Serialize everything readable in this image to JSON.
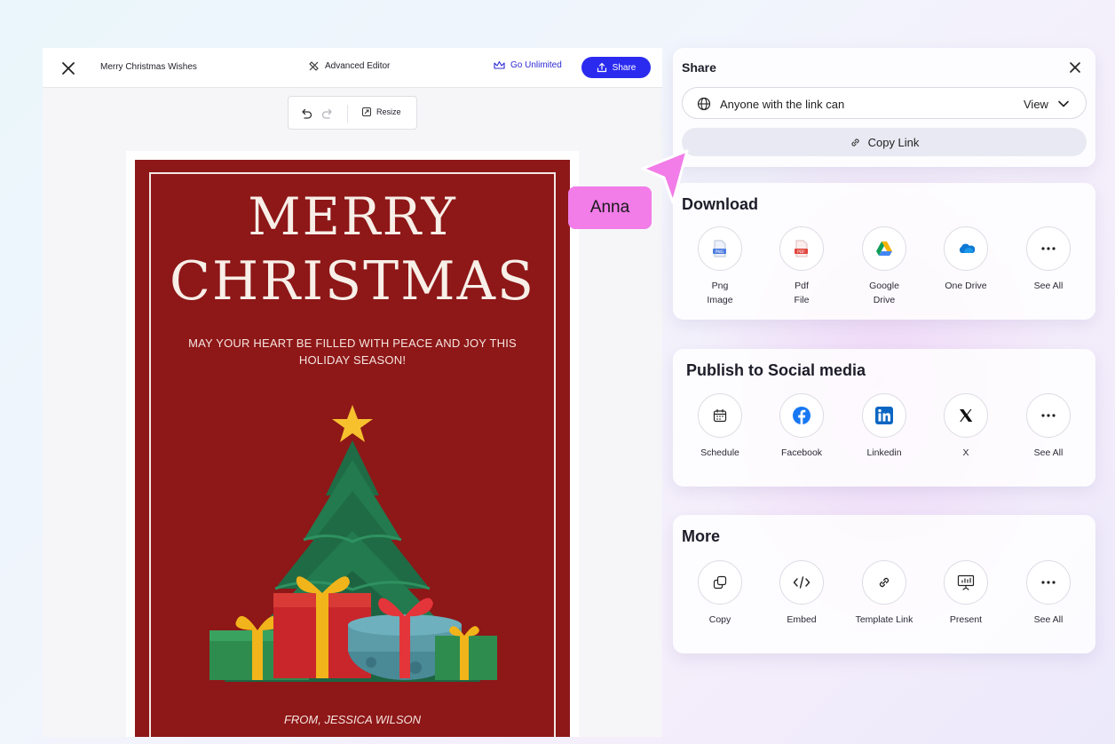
{
  "editor": {
    "doc_title": "Merry Christmas Wishes",
    "advanced_editor": "Advanced Editor",
    "go_unlimited": "Go Unlimited",
    "share": "Share",
    "resize": "Resize"
  },
  "card": {
    "line1": "MERRY",
    "line2": "CHRISTMAS",
    "wish": "MAY YOUR HEART BE FILLED WITH PEACE AND JOY THIS HOLIDAY SEASON!",
    "from": "FROM, JESSICA WILSON"
  },
  "share_panel": {
    "title": "Share",
    "access_text": "Anyone with the link can",
    "access_value": "View",
    "copy_link": "Copy Link"
  },
  "download": {
    "title": "Download",
    "options": [
      {
        "label": "Png\nImage",
        "icon": "png-file-icon"
      },
      {
        "label": "Pdf\nFile",
        "icon": "pdf-file-icon"
      },
      {
        "label": "Google\nDrive",
        "icon": "google-drive-icon"
      },
      {
        "label": "One Drive",
        "icon": "onedrive-icon"
      },
      {
        "label": "See All",
        "icon": "more-dots-icon"
      }
    ]
  },
  "social": {
    "title": "Publish to Social media",
    "options": [
      {
        "label": "Schedule",
        "icon": "calendar-icon"
      },
      {
        "label": "Facebook",
        "icon": "facebook-icon"
      },
      {
        "label": "Linkedin",
        "icon": "linkedin-icon"
      },
      {
        "label": "X",
        "icon": "x-logo-icon"
      },
      {
        "label": "See All",
        "icon": "more-dots-icon"
      }
    ]
  },
  "more": {
    "title": "More",
    "options": [
      {
        "label": "Copy",
        "icon": "copy-icon"
      },
      {
        "label": "Embed",
        "icon": "code-icon"
      },
      {
        "label": "Template Link",
        "icon": "link-icon"
      },
      {
        "label": "Present",
        "icon": "present-icon"
      },
      {
        "label": "See All",
        "icon": "more-dots-icon"
      }
    ]
  },
  "collaborator": {
    "name": "Anna",
    "color": "#f27ce8"
  },
  "colors": {
    "accent": "#2b2bf0",
    "card_red": "#8e1718"
  }
}
